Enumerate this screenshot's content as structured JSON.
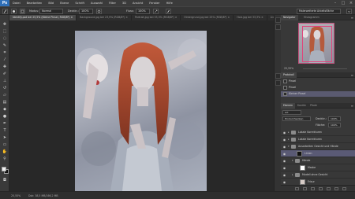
{
  "app": {
    "logo": "Ps",
    "menu": [
      "Datei",
      "Bearbeiten",
      "Bild",
      "Ebene",
      "Schrift",
      "Auswahl",
      "Filter",
      "3D",
      "Ansicht",
      "Fenster",
      "Hilfe"
    ],
    "window_controls": [
      "–",
      "□",
      "×"
    ]
  },
  "options_bar": {
    "modus_label": "Modus:",
    "modus_value": "Normal",
    "deckkraft_label": "Deckkr.:",
    "deckkraft_value": "100%",
    "fluss_label": "Fluss:",
    "fluss_value": "100%",
    "workspace": "Malerweiterte Arbeitsfläche"
  },
  "tabs": [
    {
      "label": "Identify.psd bei 25,5% (Kleine Pinsel, RGB/8*) ×",
      "active": true
    },
    {
      "label": "Background.jpg bei 23,9% (RGB/8*) ×",
      "active": false
    },
    {
      "label": "Portrait.jpg bei 33,3% (RGB/8*) ×",
      "active": false
    },
    {
      "label": "Hintergrund.jpg bei 25% (RGB/8*) ×",
      "active": false
    },
    {
      "label": "Holz.jpg bei 33,3% ×",
      "active": false
    },
    {
      "label": "Lichter.psd ×",
      "active": false
    }
  ],
  "status": {
    "zoom": "25,55%",
    "doc": "Dok: 38,5 MB/166,2 MB"
  },
  "navigator": {
    "tabs": [
      "Navigator",
      "Histogramm"
    ],
    "zoom": "25,55%"
  },
  "history": {
    "tabs": [
      "Protokoll"
    ],
    "items": [
      {
        "label": "Pinsel",
        "selected": false
      },
      {
        "label": "Pinsel",
        "selected": false
      },
      {
        "label": "Kleiner Pinsel",
        "selected": true
      }
    ]
  },
  "layers": {
    "tabs": [
      "Ebenen",
      "Kanäle",
      "Pfade"
    ],
    "kind": "Art",
    "blend_mode": "Hindurchwirken",
    "opacity_label": "Deckkr.:",
    "opacity_value": "100%",
    "fill_label": "Fläche:",
    "fill_value": "100%",
    "rows": [
      {
        "name": "Lokale Korrekturen",
        "type": "folder",
        "indent": 0,
        "selected": false
      },
      {
        "name": "Lokale Korrekturen",
        "type": "folder",
        "indent": 0,
        "selected": false
      },
      {
        "name": "Ausarbeiten Gesicht und Hände",
        "type": "folder",
        "indent": 0,
        "selected": false
      },
      {
        "name": "Linien",
        "type": "layer",
        "indent": 1,
        "selected": true
      },
      {
        "name": "Hände",
        "type": "folder",
        "indent": 1,
        "selected": false
      },
      {
        "name": "Maske",
        "type": "layer",
        "indent": 2,
        "selected": false
      },
      {
        "name": "Modell ohne Gesicht",
        "type": "folder",
        "indent": 1,
        "selected": false
      },
      {
        "name": "Frisur",
        "type": "layer",
        "indent": 2,
        "selected": false
      },
      {
        "name": "Haare gemalt",
        "type": "layer",
        "indent": 1,
        "selected": false
      },
      {
        "name": "Modell",
        "type": "folder",
        "indent": 0,
        "selected": false
      },
      {
        "name": "Modell mit Gesicht",
        "type": "layer",
        "indent": 0,
        "selected": false
      }
    ]
  }
}
